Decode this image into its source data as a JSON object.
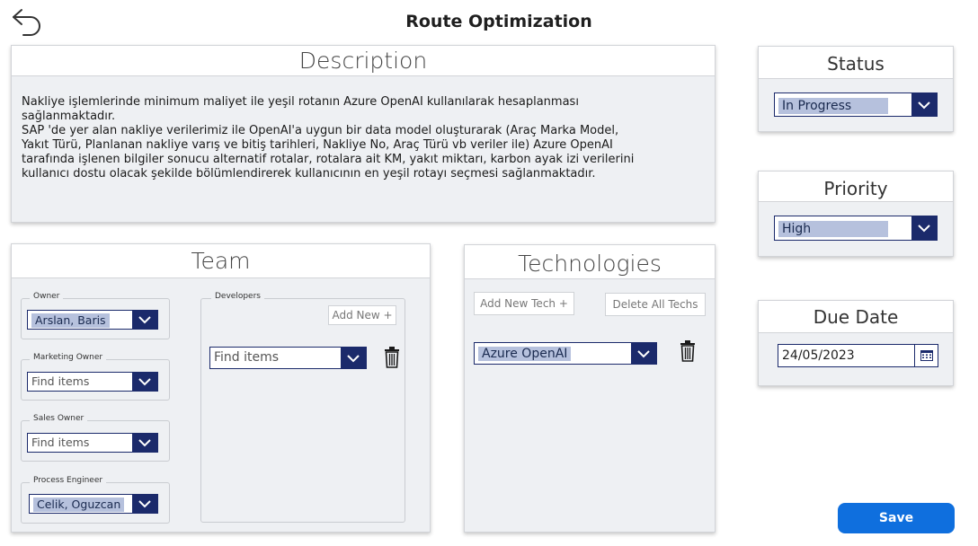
{
  "page": {
    "title": "Route Optimization"
  },
  "description": {
    "header": "Description",
    "lines": [
      "Nakliye işlemlerinde minimum maliyet ile yeşil rotanın Azure OpenAI kullanılarak hesaplanması",
      "sağlanmaktadır.",
      "SAP 'de yer alan nakliye verilerimiz ile OpenAI'a uygun bir data model oluşturarak (Araç Marka Model,",
      "Yakıt Türü, Planlanan nakliye varış ve bitiş tarihleri, Nakliye No, Araç Türü vb veriler ile) Azure OpenAI",
      "tarafında işlenen bilgiler sonucu alternatif rotalar, rotalara ait KM, yakıt miktarı, karbon ayak izi verilerini",
      "kullanıcı dostu olacak şekilde bölümlendirerek kullanıcının en yeşil rotayı seçmesi sağlanmaktadır."
    ]
  },
  "team": {
    "header": "Team",
    "owner": {
      "label": "Owner",
      "value": "Arslan, Baris"
    },
    "marketing_owner": {
      "label": "Marketing Owner",
      "placeholder": "Find items"
    },
    "sales_owner": {
      "label": "Sales Owner",
      "placeholder": "Find items"
    },
    "process_engineer": {
      "label": "Process Engineer",
      "value": "Celik, Oguzcan"
    },
    "developers": {
      "label": "Developers",
      "add_label": "Add New +",
      "placeholder": "Find items"
    }
  },
  "technologies": {
    "header": "Technologies",
    "add_label": "Add New Tech +",
    "delete_label": "Delete All Techs",
    "selected": "Azure OpenAI"
  },
  "status": {
    "header": "Status",
    "value": "In Progress"
  },
  "priority": {
    "header": "Priority",
    "value": "High"
  },
  "due_date": {
    "header": "Due Date",
    "value": "24/05/2023"
  },
  "actions": {
    "save_label": "Save"
  },
  "colors": {
    "accent": "#1b2a6b",
    "chip": "#b6c1dd",
    "save": "#0f6fde",
    "card": "#eef0f3"
  },
  "icons": [
    "back-arrow-icon",
    "chevron-down-icon",
    "trash-icon",
    "calendar-icon"
  ]
}
